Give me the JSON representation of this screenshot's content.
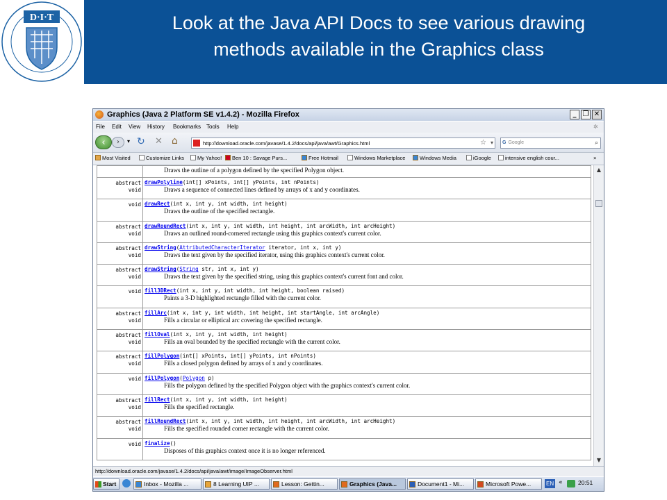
{
  "slide": {
    "title_line1": "Look at the Java API Docs to see various drawing",
    "title_line2": "methods available in the Graphics class",
    "logo_text": "D·I·T",
    "logo_ring_text": "DUBLIN INSTITUTE OF TECHNOLOGY · INSTITIÚID TEICNEOLAÍOCHTA ÁTHA CLIATH"
  },
  "browser": {
    "window_title": "Graphics (Java 2 Platform SE v1.4.2) - Mozilla Firefox",
    "menu": [
      "File",
      "Edit",
      "View",
      "History",
      "Bookmarks",
      "Tools",
      "Help"
    ],
    "url": "http://download.oracle.com/javase/1.4.2/docs/api/java/awt/Graphics.html",
    "search_placeholder": "Google",
    "bookmarks": [
      "Most Visited",
      "Customize Links",
      "My Yahoo!",
      "Ben 10 : Savage Purs...",
      "Free Hotmail",
      "Windows Marketplace",
      "Windows Media",
      "iGoogle",
      "intensive english cour..."
    ],
    "status_text": "http://download.oracle.com/javase/1.4.2/docs/api/java/awt/image/ImageObserver.html",
    "first_row_desc": "Draws the outline of a polygon defined by the specified Polygon object.",
    "methods": [
      {
        "mod1": "abstract",
        "mod2": "void",
        "name": "drawPolyline",
        "link": "",
        "sig": "(int[] xPoints, int[] yPoints, int nPoints)",
        "desc": "Draws a sequence of connected lines defined by arrays of x and y coordinates."
      },
      {
        "mod1": "",
        "mod2": "void",
        "name": "drawRect",
        "link": "",
        "sig": "(int x, int y, int width, int height)",
        "desc": "Draws the outline of the specified rectangle."
      },
      {
        "mod1": "abstract",
        "mod2": "void",
        "name": "drawRoundRect",
        "link": "",
        "sig": "(int x, int y, int width, int height, int arcWidth, int arcHeight)",
        "desc": "Draws an outlined round-cornered rectangle using this graphics context's current color."
      },
      {
        "mod1": "abstract",
        "mod2": "void",
        "name": "drawString",
        "link": "AttributedCharacterIterator",
        "sig": " iterator, int x, int y)",
        "desc": "Draws the text given by the specified iterator, using this graphics context's current color."
      },
      {
        "mod1": "abstract",
        "mod2": "void",
        "name": "drawString",
        "link": "String",
        "sig": " str, int x, int y)",
        "desc": "Draws the text given by the specified string, using this graphics context's current font and color."
      },
      {
        "mod1": "",
        "mod2": "void",
        "name": "fill3DRect",
        "link": "",
        "sig": "(int x, int y, int width, int height, boolean raised)",
        "desc": "Paints a 3-D highlighted rectangle filled with the current color."
      },
      {
        "mod1": "abstract",
        "mod2": "void",
        "name": "fillArc",
        "link": "",
        "sig": "(int x, int y, int width, int height, int startAngle, int arcAngle)",
        "desc": "Fills a circular or elliptical arc covering the specified rectangle."
      },
      {
        "mod1": "abstract",
        "mod2": "void",
        "name": "fillOval",
        "link": "",
        "sig": "(int x, int y, int width, int height)",
        "desc": "Fills an oval bounded by the specified rectangle with the current color."
      },
      {
        "mod1": "abstract",
        "mod2": "void",
        "name": "fillPolygon",
        "link": "",
        "sig": "(int[] xPoints, int[] yPoints, int nPoints)",
        "desc": "Fills a closed polygon defined by arrays of x and y coordinates."
      },
      {
        "mod1": "",
        "mod2": "void",
        "name": "fillPolygon",
        "link": "Polygon",
        "sig": " p)",
        "desc": "Fills the polygon defined by the specified Polygon object with the graphics context's current color."
      },
      {
        "mod1": "abstract",
        "mod2": "void",
        "name": "fillRect",
        "link": "",
        "sig": "(int x, int y, int width, int height)",
        "desc": "Fills the specified rectangle."
      },
      {
        "mod1": "abstract",
        "mod2": "void",
        "name": "fillRoundRect",
        "link": "",
        "sig": "(int x, int y, int width, int height, int arcWidth, int arcHeight)",
        "desc": "Fills the specified rounded corner rectangle with the current color."
      },
      {
        "mod1": "",
        "mod2": "void",
        "name": "finalize",
        "link": "",
        "sig": "()",
        "desc": "Disposes of this graphics context once it is no longer referenced."
      }
    ]
  },
  "taskbar": {
    "start_label": "Start",
    "tasks": [
      "Inbox - Mozilla ...",
      "8 Learning UIP ...",
      "Lesson: Gettin...",
      "Graphics (Java...",
      "Document1 - Mi...",
      "Microsoft Powe..."
    ],
    "active_task_index": 3,
    "language": "EN",
    "clock": "20:51"
  },
  "colors": {
    "slide_header": "#0b5196",
    "link": "#0000ee"
  }
}
